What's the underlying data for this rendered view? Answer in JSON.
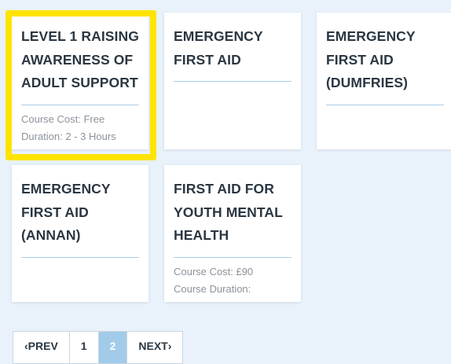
{
  "courses": [
    {
      "title_lines": [
        "LEVEL 1 RAISING",
        "AWARENESS OF",
        "ADULT SUPPORT"
      ],
      "meta": [
        "Course Cost: Free",
        "Duration: 2 - 3 Hours"
      ]
    },
    {
      "title_lines": [
        "EMERGENCY",
        "FIRST AID"
      ],
      "meta": []
    },
    {
      "title_lines": [
        "EMERGENCY",
        "FIRST AID",
        "(DUMFRIES)"
      ],
      "meta": []
    },
    {
      "title_lines": [
        "EMERGENCY",
        "FIRST AID",
        "(ANNAN)"
      ],
      "meta": []
    },
    {
      "title_lines": [
        "FIRST AID FOR",
        "YOUTH MENTAL",
        "HEALTH"
      ],
      "meta": [
        "Course Cost: £90",
        "Course Duration:"
      ]
    }
  ],
  "highlight": {
    "color": "#ffe400"
  },
  "pagination": {
    "prev": "‹PREV",
    "pages": [
      "1",
      "2"
    ],
    "current": "2",
    "next": "NEXT›"
  }
}
